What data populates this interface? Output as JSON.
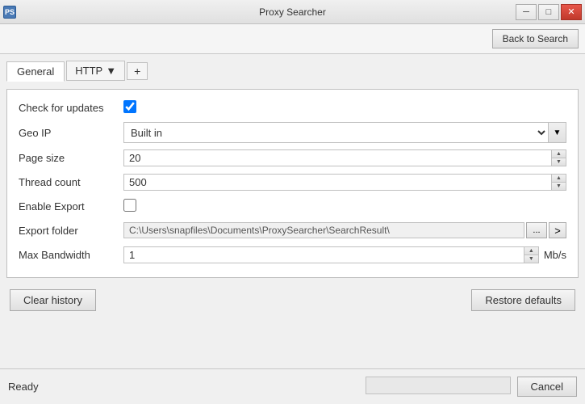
{
  "titleBar": {
    "title": "Proxy Searcher",
    "iconLabel": "PS",
    "minBtn": "─",
    "maxBtn": "□",
    "closeBtn": "✕"
  },
  "toolbar": {
    "backBtn": "Back to Search"
  },
  "tabs": {
    "general": "General",
    "http": "HTTP",
    "addBtn": "+"
  },
  "form": {
    "checkForUpdatesLabel": "Check for updates",
    "geoIpLabel": "Geo IP",
    "geoIpValue": "Built in",
    "pageSizeLabel": "Page size",
    "pageSizeValue": "20",
    "threadCountLabel": "Thread count",
    "threadCountValue": "500",
    "enableExportLabel": "Enable Export",
    "exportFolderLabel": "Export folder",
    "exportFolderValue": "C:\\Users\\snapfiles\\Documents\\ProxySearcher\\SearchResult\\",
    "browseBtnLabel": "...",
    "goBtnLabel": ">",
    "maxBandwidthLabel": "Max Bandwidth",
    "maxBandwidthValue": "1",
    "maxBandwidthUnit": "Mb/s"
  },
  "footerButtons": {
    "clearHistory": "Clear history",
    "restoreDefaults": "Restore defaults"
  },
  "statusBar": {
    "statusText": "Ready",
    "cancelBtn": "Cancel"
  }
}
